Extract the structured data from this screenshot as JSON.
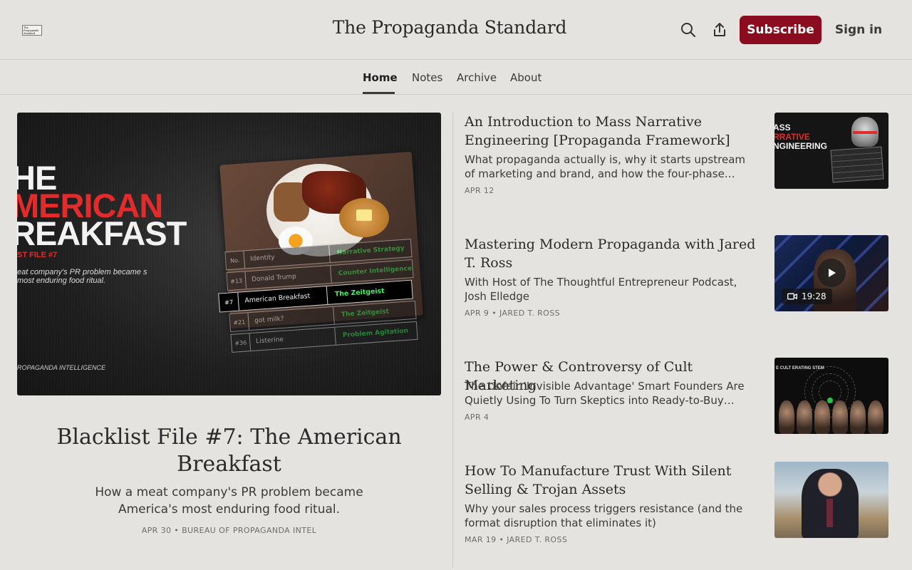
{
  "site": {
    "title": "The Propaganda Standard",
    "logo_text": "The Propaganda Standard",
    "subscribe_label": "Subscribe",
    "signin_label": "Sign in"
  },
  "nav": {
    "items": [
      {
        "label": "Home",
        "active": true
      },
      {
        "label": "Notes",
        "active": false
      },
      {
        "label": "Archive",
        "active": false
      },
      {
        "label": "About",
        "active": false
      }
    ]
  },
  "featured": {
    "title": "Blacklist File #7: The American Breakfast",
    "subtitle": "How a meat company's PR problem became America's most enduring food ritual.",
    "meta": "APR 30 • BUREAU OF PROPAGANDA INTEL",
    "image": {
      "line1": "HE",
      "line2": "MERICAN",
      "line3": "REAKFAST",
      "file_label": "ST FILE #7",
      "sub": "eat company's PR problem became s most enduring food ritual.",
      "footer": "ROPAGANDA INTELLIGENCE",
      "table": [
        {
          "no": "No.",
          "identity": "Identity",
          "strategy": "Narrative Strategy",
          "style": "dim"
        },
        {
          "no": "#13",
          "identity": "Donald Trump",
          "strategy": "Counter Intelligence",
          "style": "dim"
        },
        {
          "no": "#7",
          "identity": "American Breakfast",
          "strategy": "The Zeitgeist",
          "style": "hl"
        },
        {
          "no": "#21",
          "identity": "got milk?",
          "strategy": "The Zeitgeist",
          "style": "dim"
        },
        {
          "no": "#36",
          "identity": "Listerine",
          "strategy": "Problem Agitation",
          "style": "dim"
        }
      ]
    }
  },
  "posts": [
    {
      "title": "An Introduction to Mass Narrative Engineering [Propaganda Framework]",
      "subtitle": "What propaganda actually is, why it starts upstream of marketing and brand, and how the four-phase…",
      "meta": "APR 12",
      "thumb": {
        "line1": "ASS",
        "line2": "RRATIVE",
        "line3": "NGINEERING"
      }
    },
    {
      "title": "Mastering Modern Propaganda with Jared T. Ross",
      "subtitle": "With Host of The Thoughtful Entrepreneur Podcast, Josh Elledge",
      "meta": "APR 9 • JARED T. ROSS",
      "thumb": {
        "duration": "19:28"
      }
    },
    {
      "title": "The Power & Controversy of Cult Marketing",
      "subtitle": "The Unfair 'Invisible Advantage' Smart Founders Are Quietly Using To Turn Skeptics into Ready-to-Buy…",
      "meta": "APR 4",
      "thumb": {
        "label": "E CULT ERATING STEM"
      }
    },
    {
      "title": "How To Manufacture Trust With Silent Selling & Trojan Assets",
      "subtitle": "Why your sales process triggers resistance (and the format disruption that eliminates it)",
      "meta": "MAR 19 • JARED T. ROSS",
      "thumb": {}
    }
  ],
  "colors": {
    "accent": "#8b0b1f",
    "background": "#e5e3df",
    "text": "#2a2a2a"
  },
  "icons": {
    "search": "search-icon",
    "share": "share-icon",
    "play": "play-icon",
    "video": "video-camera-icon"
  }
}
